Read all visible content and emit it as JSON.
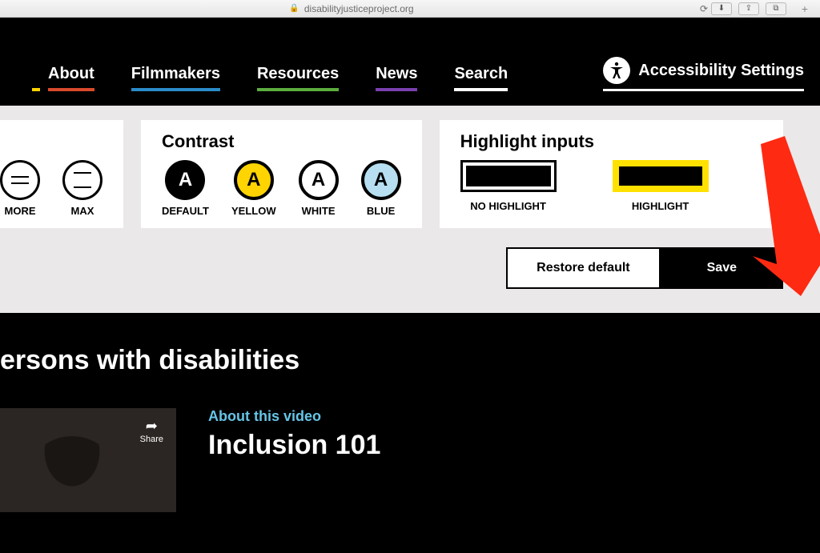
{
  "browser": {
    "url": "disabilityjusticeproject.org"
  },
  "nav": {
    "items": [
      {
        "label": "About",
        "color": "#d94a2b"
      },
      {
        "label": "Filmmakers",
        "color": "#2a8cc9"
      },
      {
        "label": "Resources",
        "color": "#5cae3e"
      },
      {
        "label": "News",
        "color": "#7a3fae"
      },
      {
        "label": "Search",
        "color": "#ffffff"
      }
    ],
    "accessibility_label": "Accessibility Settings",
    "preload": {
      "yellow": "#ffd400"
    }
  },
  "spacing": {
    "title": "",
    "options": [
      {
        "label": "MORE"
      },
      {
        "label": "MAX"
      }
    ]
  },
  "contrast": {
    "title": "Contrast",
    "options": [
      {
        "label": "DEFAULT",
        "bg": "#000000",
        "fg": "#ffffff"
      },
      {
        "label": "YELLOW",
        "bg": "#ffd400",
        "fg": "#000000"
      },
      {
        "label": "WHITE",
        "bg": "#ffffff",
        "fg": "#000000"
      },
      {
        "label": "BLUE",
        "bg": "#b7dff1",
        "fg": "#000000"
      }
    ]
  },
  "highlight": {
    "title": "Highlight inputs",
    "no_label": "NO HIGHLIGHT",
    "yes_label": "HIGHLIGHT"
  },
  "buttons": {
    "restore": "Restore default",
    "save": "Save"
  },
  "content": {
    "headline": "ersons with disabilities",
    "share": "Share",
    "about_label": "About this video",
    "video_title": "Inclusion 101"
  }
}
